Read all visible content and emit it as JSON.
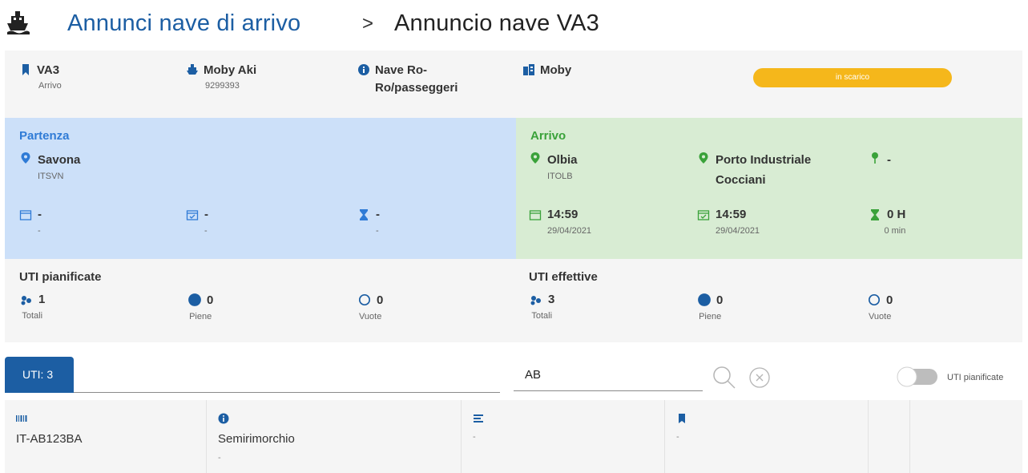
{
  "header": {
    "logo_icon": "ship-icon",
    "breadcrumb_parent": "Annunci nave di arrivo",
    "separator": ">",
    "breadcrumb_current": "Annuncio nave VA3"
  },
  "info": {
    "code": {
      "icon": "bookmark-icon",
      "value": "VA3",
      "sub": "Arrivo"
    },
    "ship": {
      "icon": "ship-icon",
      "value": "Moby Aki",
      "sub": "9299393"
    },
    "type": {
      "icon": "info-icon",
      "line1": "Nave Ro-",
      "line2": "Ro/passeggeri"
    },
    "company": {
      "icon": "company-icon",
      "value": "Moby"
    },
    "status": {
      "label": "in scarico",
      "color": "#f5b71b"
    }
  },
  "departure": {
    "title": "Partenza",
    "location": {
      "icon": "location-pin-icon",
      "value": "Savona",
      "sub": "ITSVN"
    },
    "date": {
      "icon": "calendar-icon",
      "value": "-",
      "sub": "-"
    },
    "date_confirmed": {
      "icon": "calendar-check-icon",
      "value": "-",
      "sub": "-"
    },
    "duration": {
      "icon": "hourglass-icon",
      "value": "-",
      "sub": "-"
    }
  },
  "arrival": {
    "title": "Arrivo",
    "location": {
      "icon": "location-pin-icon",
      "value": "Olbia",
      "sub": "ITOLB"
    },
    "terminal": {
      "icon": "location-pin-icon",
      "line1": "Porto Industriale",
      "line2": "Cocciani"
    },
    "berth": {
      "icon": "pin-icon",
      "value": "-"
    },
    "date": {
      "icon": "calendar-icon",
      "value": "14:59",
      "sub": "29/04/2021"
    },
    "date_confirmed": {
      "icon": "calendar-check-icon",
      "value": "14:59",
      "sub": "29/04/2021"
    },
    "duration": {
      "icon": "hourglass-icon",
      "value": "0 H",
      "sub": "0 min"
    }
  },
  "uti_planned": {
    "title": "UTI pianificate",
    "total": {
      "icon": "units-icon",
      "value": "1",
      "sub": "Totali"
    },
    "full": {
      "icon": "full-circle-icon",
      "value": "0",
      "sub": "Piene"
    },
    "empty": {
      "icon": "empty-circle-icon",
      "value": "0",
      "sub": "Vuote"
    }
  },
  "uti_actual": {
    "title": "UTI effettive",
    "total": {
      "icon": "units-icon",
      "value": "3",
      "sub": "Totali"
    },
    "full": {
      "icon": "full-circle-icon",
      "value": "0",
      "sub": "Piene"
    },
    "empty": {
      "icon": "empty-circle-icon",
      "value": "0",
      "sub": "Vuote"
    }
  },
  "toolbar": {
    "tab_label": "UTI: 3",
    "search_value": "AB",
    "toggle_label": "UTI pianificate",
    "toggle_on": false
  },
  "results": [
    {
      "id": {
        "icon": "barcode-icon",
        "value": "IT-AB123BA"
      },
      "type": {
        "icon": "info-icon",
        "value": "Semirimorchio",
        "sub": "-"
      },
      "list": {
        "icon": "list-icon",
        "sub": "-"
      },
      "tag": {
        "icon": "bookmark-icon",
        "sub": "-"
      }
    }
  ],
  "colors": {
    "primary": "#1c5ea3",
    "departure_bg": "#cce0f9",
    "arrival_bg": "#d8ecd3",
    "departure_accent": "#2f7bd6",
    "arrival_accent": "#3aa23a"
  }
}
